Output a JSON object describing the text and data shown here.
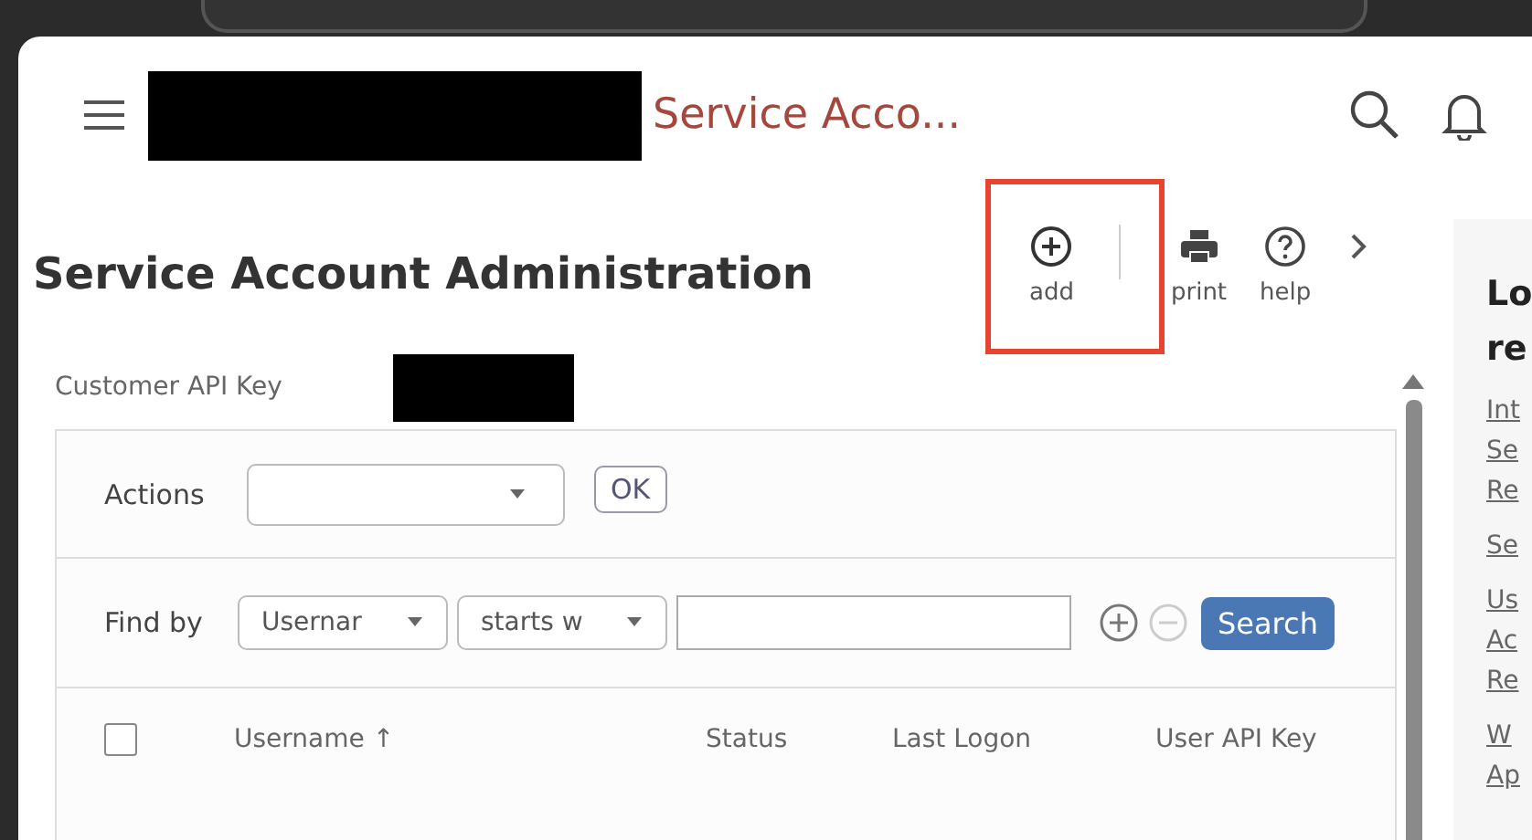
{
  "header": {
    "title": "Service Acco..."
  },
  "page": {
    "title": "Service Account Administration"
  },
  "toolbar": [
    {
      "label": "add",
      "kind": "add",
      "highlighted": true
    },
    {
      "label": "print",
      "kind": "print",
      "highlighted": false
    },
    {
      "label": "help",
      "kind": "help",
      "highlighted": false
    }
  ],
  "field": {
    "label": "Customer API Key"
  },
  "actions": {
    "label": "Actions",
    "button": "OK"
  },
  "find": {
    "label": "Find by",
    "field": "Usernar",
    "operator": "starts w",
    "button": "Search"
  },
  "table": {
    "select_all": {
      "checked": false
    },
    "columns": [
      {
        "label": "Username ↑"
      },
      {
        "label": "Status"
      },
      {
        "label": "Last Logon"
      },
      {
        "label": "User API Key"
      }
    ]
  },
  "side_panel": {
    "heading": [
      "Lo",
      "re"
    ],
    "link_groups": [
      [
        "Int",
        "Se",
        "Re"
      ],
      [
        "Se"
      ],
      [
        "Us",
        "Ac",
        "Re"
      ],
      [
        "W",
        "Ap"
      ]
    ]
  }
}
